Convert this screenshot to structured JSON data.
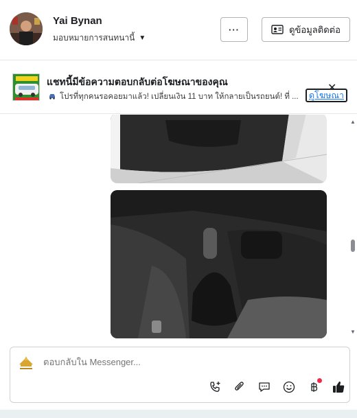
{
  "header": {
    "name": "Yai Bynan",
    "assign_label": "มอบหมายการสนทนานี้",
    "more_label": "···",
    "contact_label": "ดูข้อมูลติดต่อ"
  },
  "ad": {
    "title": "แชทนี้มีข้อความตอบกลับต่อโฆษณาของคุณ",
    "text": "โปรที่ทุกคนรอคอยมาแล้ว! เปลี่ยนเงิน 11 บาท ให้กลายเป็นรถยนต์! ที่ ...",
    "link_label": "ดูโฆษณา",
    "close_label": "✕"
  },
  "composer": {
    "placeholder": "ตอบกลับใน Messenger..."
  },
  "icons": {
    "call_add": "phone-plus-icon",
    "attach": "paperclip-icon",
    "saved_replies": "chat-bubble-icon",
    "emoji": "smiley-icon",
    "payment": "baht-icon",
    "like": "thumbs-up-icon"
  },
  "colors": {
    "link": "#1877f2",
    "notification_dot": "#f02849"
  }
}
